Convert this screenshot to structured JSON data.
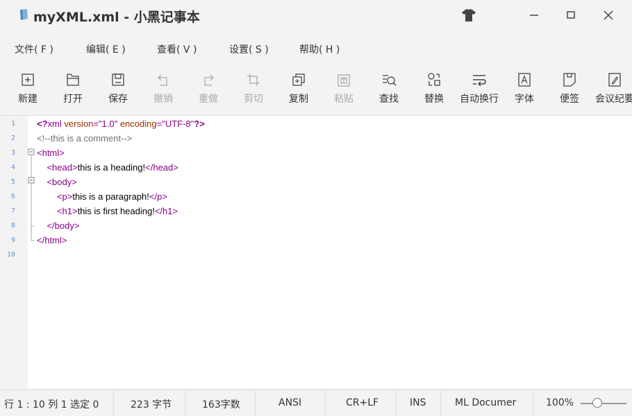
{
  "window": {
    "title": "myXML.xml - 小黑记事本"
  },
  "menu": [
    {
      "label": "文件( F )"
    },
    {
      "label": "编辑( E )"
    },
    {
      "label": "查看( V )"
    },
    {
      "label": "设置( S )"
    },
    {
      "label": "帮助( H )"
    }
  ],
  "toolbar": [
    {
      "label": "新建",
      "icon": "new-file-icon",
      "enabled": true
    },
    {
      "label": "打开",
      "icon": "open-folder-icon",
      "enabled": true
    },
    {
      "label": "保存",
      "icon": "save-icon",
      "enabled": true
    },
    {
      "label": "撤销",
      "icon": "undo-icon",
      "enabled": false
    },
    {
      "label": "重做",
      "icon": "redo-icon",
      "enabled": false
    },
    {
      "label": "剪切",
      "icon": "crop-cut-icon",
      "enabled": false
    },
    {
      "label": "复制",
      "icon": "copy-icon",
      "enabled": true
    },
    {
      "label": "粘贴",
      "icon": "paste-icon",
      "enabled": false
    },
    {
      "label": "查找",
      "icon": "find-icon",
      "enabled": true
    },
    {
      "label": "替换",
      "icon": "replace-icon",
      "enabled": true
    },
    {
      "label": "自动换行",
      "icon": "word-wrap-icon",
      "enabled": true
    },
    {
      "label": "字体",
      "icon": "font-icon",
      "enabled": true
    },
    {
      "label": "便签",
      "icon": "note-icon",
      "enabled": true
    },
    {
      "label": "会议纪要",
      "icon": "minutes-icon",
      "enabled": true
    }
  ],
  "editor": {
    "line_numbers": [
      "1",
      "2",
      "3",
      "4",
      "5",
      "6",
      "7",
      "8",
      "9",
      "10"
    ],
    "lines": [
      {
        "tokens": [
          [
            "pi",
            "<?"
          ],
          [
            "tag",
            "xml "
          ],
          [
            "attr",
            "version"
          ],
          [
            "tag",
            "="
          ],
          [
            "val",
            "\"1.0\" "
          ],
          [
            "attr",
            "encoding"
          ],
          [
            "tag",
            "="
          ],
          [
            "val",
            "\"UTF-8\""
          ],
          [
            "pi",
            "?>"
          ]
        ]
      },
      {
        "tokens": [
          [
            "cmt",
            "<!--this is a comment-->"
          ]
        ]
      },
      {
        "tokens": [
          [
            "tag",
            "<html>"
          ]
        ]
      },
      {
        "tokens": [
          [
            "txt",
            "    "
          ],
          [
            "tag",
            "<head>"
          ],
          [
            "txt",
            "this is a heading!"
          ],
          [
            "tag",
            "</head>"
          ]
        ]
      },
      {
        "tokens": [
          [
            "txt",
            "    "
          ],
          [
            "tag",
            "<body>"
          ]
        ]
      },
      {
        "tokens": [
          [
            "txt",
            "        "
          ],
          [
            "tag",
            "<p>"
          ],
          [
            "txt",
            "this is a paragraph!"
          ],
          [
            "tag",
            "</p>"
          ]
        ]
      },
      {
        "tokens": [
          [
            "txt",
            "        "
          ],
          [
            "tag",
            "<h1>"
          ],
          [
            "txt",
            "this is first heading!"
          ],
          [
            "tag",
            "</h1>"
          ]
        ]
      },
      {
        "tokens": [
          [
            "txt",
            "    "
          ],
          [
            "tag",
            "</body>"
          ]
        ]
      },
      {
        "tokens": [
          [
            "tag",
            "</html>"
          ]
        ]
      },
      {
        "tokens": []
      }
    ]
  },
  "status": {
    "position": "行 1 : 10   列 1   选定 0",
    "bytes": "223 字节",
    "chars": "163字数",
    "encoding": "ANSI",
    "line_ending": "CR+LF",
    "mode": "INS",
    "doc_type": "ML Documer",
    "zoom": "100%"
  },
  "colors": {
    "tag": "#8b008b",
    "attr": "#9b2c00",
    "comment": "#6e6e6e",
    "line_number": "#6a8fc8"
  }
}
